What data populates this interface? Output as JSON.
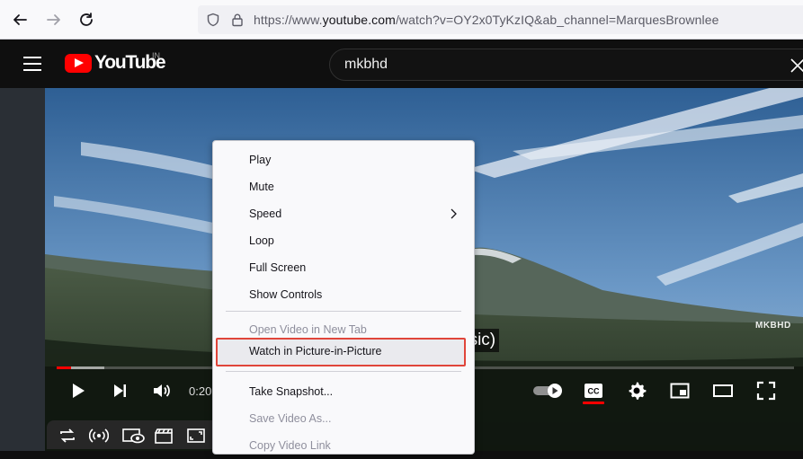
{
  "browser": {
    "url_prefix": "https://www.",
    "url_domain": "youtube.com",
    "url_rest": "/watch?v=OY2x0TyKzIQ&ab_channel=MarquesBrownlee"
  },
  "youtube": {
    "logo_text": "YouTube",
    "country_code": "IN",
    "search_value": "mkbhd"
  },
  "video": {
    "watermark": "MKBHD",
    "caption": "usic)",
    "time": "0:20",
    "progress_played": 0.02,
    "progress_buffered": 0.065
  },
  "context_menu": {
    "items": [
      {
        "label": "Play",
        "enabled": true
      },
      {
        "label": "Mute",
        "enabled": true
      },
      {
        "label": "Speed",
        "enabled": true,
        "submenu": true
      },
      {
        "label": "Loop",
        "enabled": true
      },
      {
        "label": "Full Screen",
        "enabled": true
      },
      {
        "label": "Show Controls",
        "enabled": true
      },
      {
        "label": "Open Video in New Tab",
        "enabled": false
      },
      {
        "label": "Watch in Picture-in-Picture",
        "enabled": true,
        "highlighted": true
      },
      {
        "label": "Take Snapshot...",
        "enabled": true
      },
      {
        "label": "Save Video As...",
        "enabled": false
      },
      {
        "label": "Copy Video Link",
        "enabled": false
      }
    ]
  },
  "colors": {
    "brand_red": "#ff0000",
    "highlight_border": "#e0453a"
  }
}
